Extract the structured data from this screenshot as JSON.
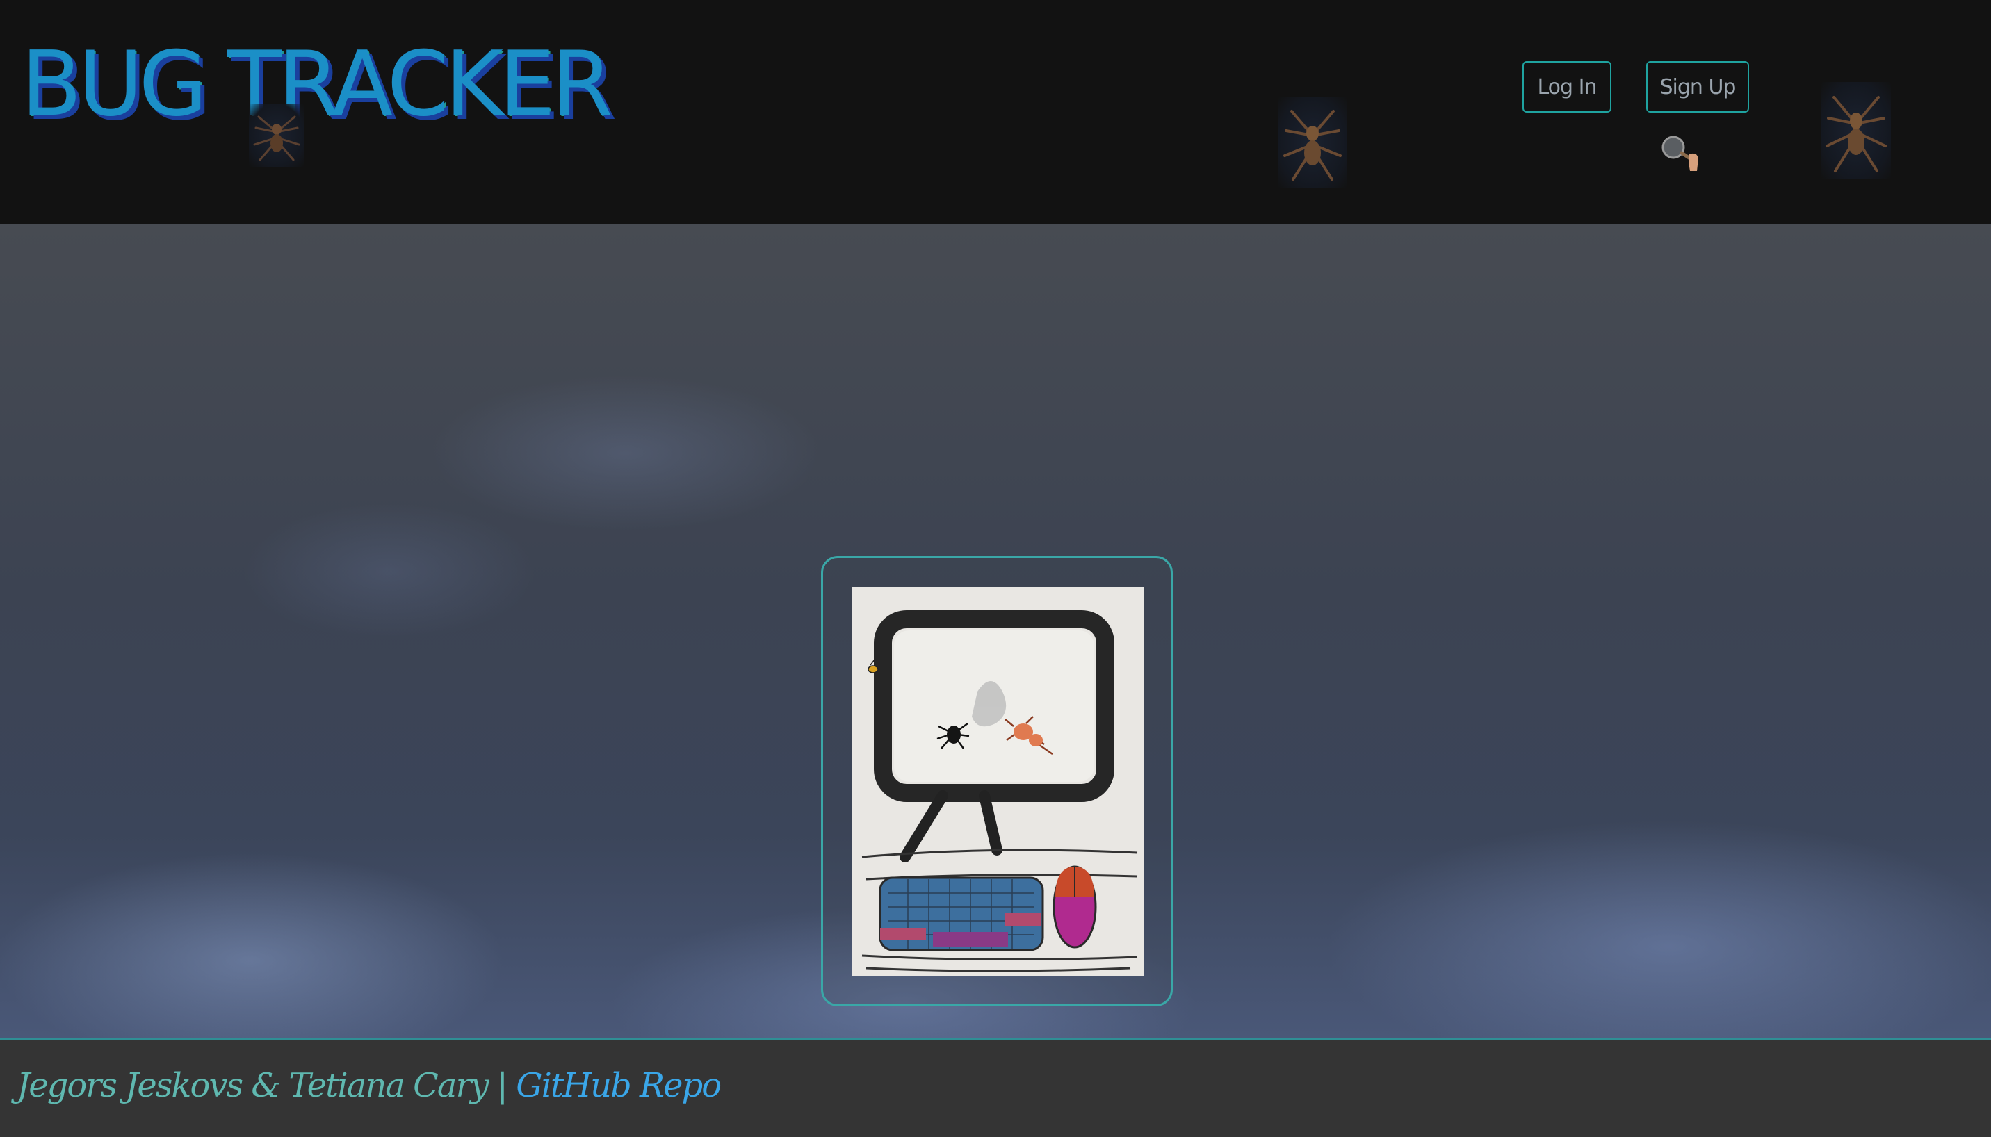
{
  "header": {
    "brand": "BUG TRACKER",
    "login_label": "Log In",
    "signup_label": "Sign Up"
  },
  "icons": {
    "spider": "spider-icon",
    "magnifier": "magnifying-glass-icon"
  },
  "footer": {
    "authors": "Jegors Jeskovs & Tetiana Cary",
    "separator": "|",
    "repo_link": "GitHub Repo"
  },
  "colors": {
    "brand": "#1b8fc7",
    "accent": "#1fa3a0",
    "link": "#3aa6e8"
  }
}
